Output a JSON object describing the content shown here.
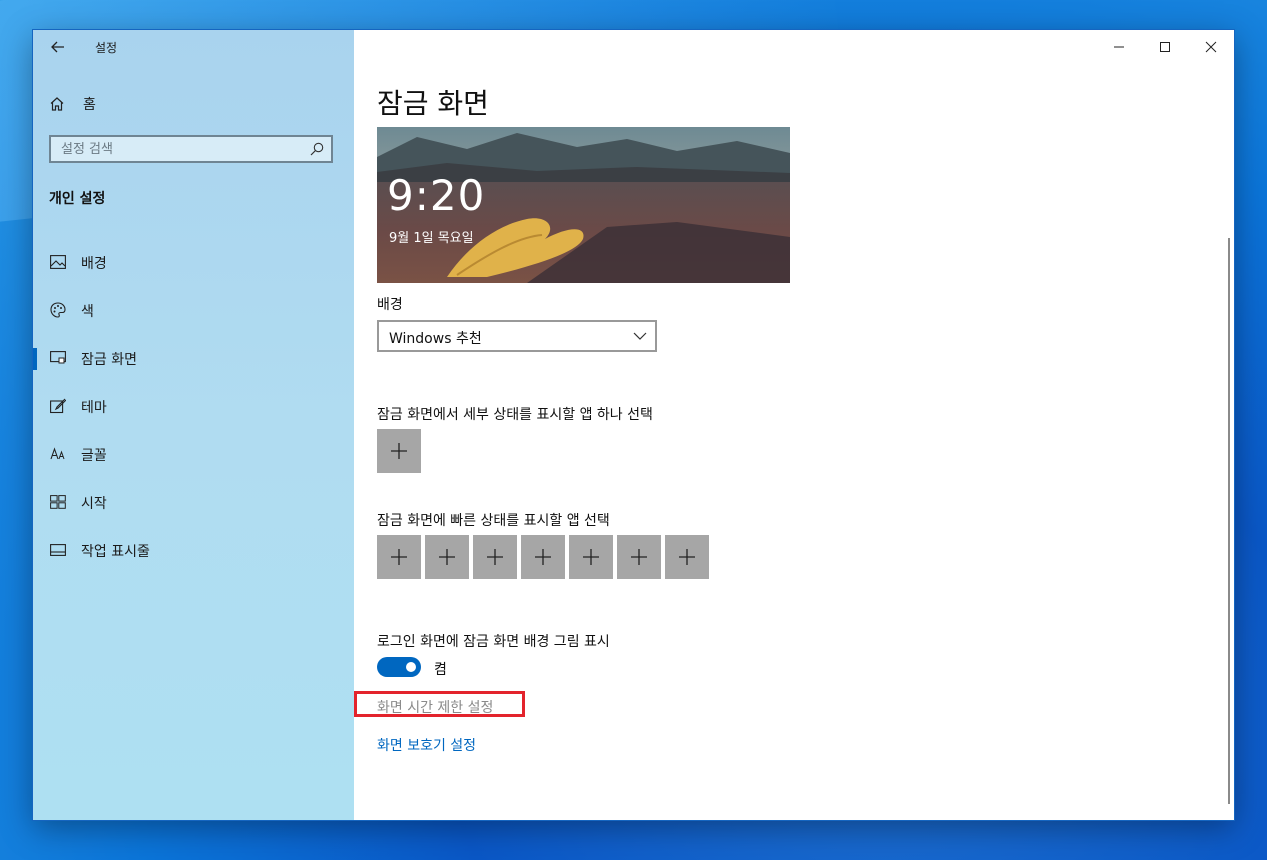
{
  "window": {
    "title": "설정",
    "controls": [
      "minimize",
      "maximize",
      "close"
    ]
  },
  "sidebar": {
    "home_label": "홈",
    "search_placeholder": "설정 검색",
    "section_title": "개인 설정",
    "items": [
      {
        "label": "배경",
        "icon": "picture-icon",
        "selected": false
      },
      {
        "label": "색",
        "icon": "palette-icon",
        "selected": false
      },
      {
        "label": "잠금 화면",
        "icon": "lock-screen-icon",
        "selected": true
      },
      {
        "label": "테마",
        "icon": "theme-brush-icon",
        "selected": false
      },
      {
        "label": "글꼴",
        "icon": "font-icon",
        "selected": false
      },
      {
        "label": "시작",
        "icon": "start-grid-icon",
        "selected": false
      },
      {
        "label": "작업 표시줄",
        "icon": "taskbar-icon",
        "selected": false
      }
    ]
  },
  "main": {
    "page_title": "잠금 화면",
    "preview": {
      "time": "9:20",
      "date": "9월 1일 목요일"
    },
    "background_label": "배경",
    "background_value": "Windows 추천",
    "detailed_status_label": "잠금 화면에서 세부 상태를 표시할 앱 하나 선택",
    "quick_status_label": "잠금 화면에 빠른 상태를 표시할 앱 선택",
    "quick_status_slot_count": 7,
    "signin_label": "로그인 화면에 잠금 화면 배경 그림 표시",
    "toggle_state": "켬",
    "toggle_on": true,
    "timeout_link": "화면 시간 제한 설정",
    "screensaver_link": "화면 보호기 설정"
  },
  "colors": {
    "accent": "#0067c0",
    "highlight_box": "#e3232c",
    "tile": "#a6a6a6"
  }
}
